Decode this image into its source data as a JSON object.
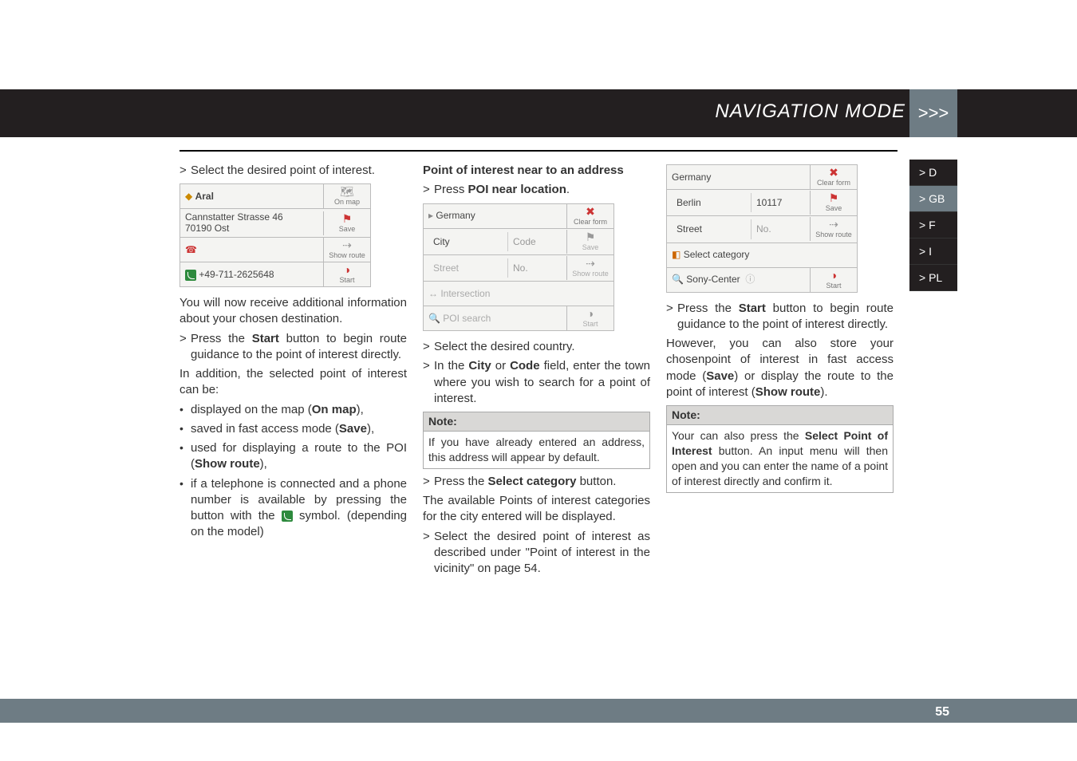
{
  "header": {
    "title": "NAVIGATION MODE",
    "chevrons": ">>>"
  },
  "side_tabs": {
    "items": [
      {
        "label": "> D",
        "active": false
      },
      {
        "label": "> GB",
        "active": true
      },
      {
        "label": "> F",
        "active": false
      },
      {
        "label": "> I",
        "active": false
      },
      {
        "label": "> PL",
        "active": false
      }
    ]
  },
  "footer": {
    "page_number": "55"
  },
  "col1": {
    "line_select_poi": "Select the desired point of interest.",
    "dev1": {
      "name": "Aral",
      "addr1": "Cannstatter Strasse 46",
      "addr2": "70190 Ost",
      "phone": "+49-711-2625648",
      "btn_onmap": "On map",
      "btn_save": "Save",
      "btn_route": "Show route",
      "btn_start": "Start"
    },
    "para_receive": "You will now receive additional information about your chosen destination.",
    "gt_start_pre": "Press the ",
    "gt_start_bold": "Start",
    "gt_start_post": " button to begin route guidance to the point of interest directly.",
    "para_inaddition": "In addition, the selected point of interest can be:",
    "b1_pre": "displayed on the map (",
    "b1_bold": "On map",
    "b1_post": "),",
    "b2_pre": "saved in fast access mode (",
    "b2_bold": "Save",
    "b2_post": "),",
    "b3_pre": "used for displaying a route to the POI (",
    "b3_bold": "Show route",
    "b3_post": "),",
    "b4_a": "if a telephone is connected and a phone number is available by pressing the button with the ",
    "b4_b": " symbol. (depending on the model)"
  },
  "col2": {
    "heading": "Point of interest near to an address",
    "gt_press_pre": "Press ",
    "gt_press_bold": "POI near location",
    "gt_press_post": ".",
    "dev2": {
      "country": "Germany",
      "city": "City",
      "code": "Code",
      "street": "Street",
      "no": "No.",
      "inter": "Intersection",
      "poi": "POI search",
      "btn_clear": "Clear form",
      "btn_save": "Save",
      "btn_route": "Show route",
      "btn_start": "Start"
    },
    "gt_country": "Select the desired country.",
    "gt_city_pre": "In the ",
    "gt_city_b1": "City",
    "gt_city_mid": " or ",
    "gt_city_b2": "Code",
    "gt_city_post": " field, enter the town where you wish to search for a point of interest.",
    "note_label": "Note:",
    "note_body": "If you have already entered an address, this address will appear by default.",
    "gt_cat_pre": "Press the ",
    "gt_cat_bold": "Select category",
    "gt_cat_post": " button.",
    "para_available": "The available Points of interest categories for the city entered will be displayed.",
    "gt_desc": "Select the desired point of interest as described under \"Point of interest in the vicinity\" on page 54."
  },
  "col3": {
    "dev3": {
      "country": "Germany",
      "city": "Berlin",
      "zip": "10117",
      "street": "Street",
      "no": "No.",
      "cat": "Select category",
      "center": "Sony-Center",
      "btn_clear": "Clear form",
      "btn_save": "Save",
      "btn_route": "Show route",
      "btn_start": "Start"
    },
    "gt_start_pre": "Press the ",
    "gt_start_bold": "Start",
    "gt_start_post": " button to begin route guidance to the point of interest directly.",
    "para_however_a": "However, you can also store your chosenpoint of interest in fast access mode (",
    "para_however_b1": "Save",
    "para_however_b": ") or display the route to the point of interest (",
    "para_however_b2": "Show route",
    "para_however_c": ").",
    "note_label": "Note:",
    "note_body_a": "Your can also press the ",
    "note_body_b1": "Select Point of Interest",
    "note_body_b": " button. An input menu will then open and you can enter the name of a point of interest directly and confirm it."
  }
}
